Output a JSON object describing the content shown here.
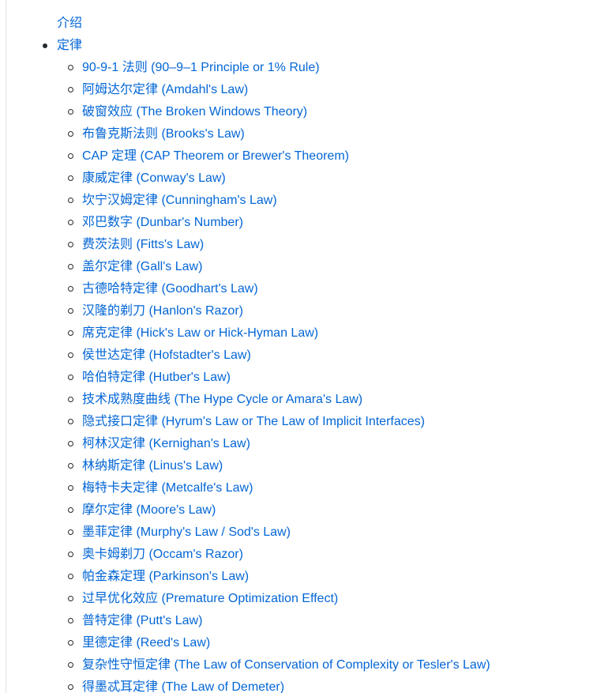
{
  "toc": {
    "items": [
      {
        "label": "介绍"
      },
      {
        "label": "定律",
        "children": [
          "90-9-1 法则 (90–9–1 Principle or 1% Rule)",
          "阿姆达尔定律 (Amdahl's Law)",
          "破窗效应 (The Broken Windows Theory)",
          "布鲁克斯法则 (Brooks's Law)",
          "CAP 定理 (CAP Theorem or Brewer's Theorem)",
          "康威定律 (Conway's Law)",
          "坎宁汉姆定律 (Cunningham's Law)",
          "邓巴数字 (Dunbar's Number)",
          "费茨法则 (Fitts's Law)",
          "盖尔定律 (Gall's Law)",
          "古德哈特定律 (Goodhart's Law)",
          "汉隆的剃刀 (Hanlon's Razor)",
          "席克定律 (Hick's Law or Hick-Hyman Law)",
          "侯世达定律 (Hofstadter's Law)",
          "哈伯特定律 (Hutber's Law)",
          "技术成熟度曲线 (The Hype Cycle or Amara's Law)",
          "隐式接口定律 (Hyrum's Law or The Law of Implicit Interfaces)",
          "柯林汉定律 (Kernighan's Law)",
          "林纳斯定律 (Linus's Law)",
          "梅特卡夫定律 (Metcalfe's Law)",
          "摩尔定律 (Moore's Law)",
          "墨菲定律 (Murphy's Law / Sod's Law)",
          "奥卡姆剃刀 (Occam's Razor)",
          "帕金森定理 (Parkinson's Law)",
          "过早优化效应 (Premature Optimization Effect)",
          "普特定律 (Putt's Law)",
          "里德定律 (Reed's Law)",
          "复杂性守恒定律 (The Law of Conservation of Complexity or Tesler's Law)",
          "得墨忒耳定律 (The Law of Demeter)"
        ]
      }
    ]
  },
  "colors": {
    "link": "#0366d6",
    "bullet": "#24292e",
    "rule": "#e1e4e8"
  }
}
